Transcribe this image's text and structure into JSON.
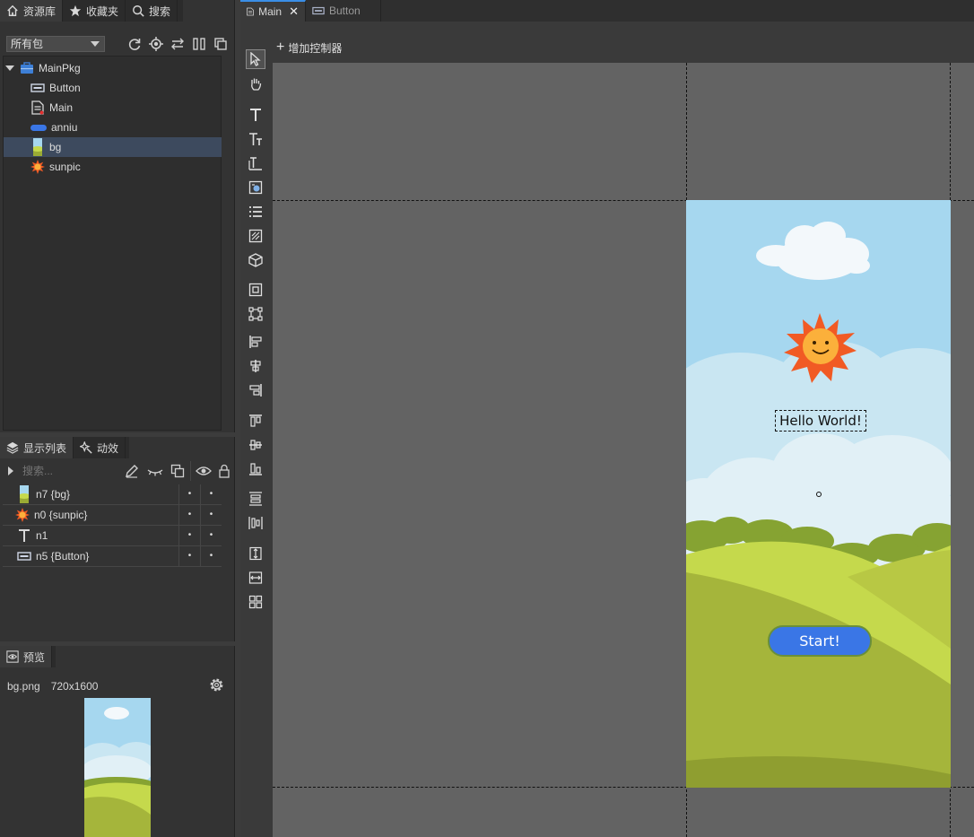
{
  "library": {
    "tabs": [
      {
        "label": "资源库",
        "icon": "home-icon"
      },
      {
        "label": "收藏夹",
        "icon": "star-icon"
      },
      {
        "label": "搜索",
        "icon": "search-icon"
      }
    ],
    "package_select": "所有包",
    "tree": [
      {
        "label": "MainPkg",
        "icon": "package-icon",
        "level": 0,
        "selected": false
      },
      {
        "label": "Button",
        "icon": "button-component-icon",
        "level": 1,
        "selected": false
      },
      {
        "label": "Main",
        "icon": "document-icon",
        "level": 1,
        "selected": false
      },
      {
        "label": "anniu",
        "icon": "blue-pill-image-icon",
        "level": 1,
        "selected": false
      },
      {
        "label": "bg",
        "icon": "background-image-icon",
        "level": 1,
        "selected": true
      },
      {
        "label": "sunpic",
        "icon": "sun-image-icon",
        "level": 1,
        "selected": false
      }
    ]
  },
  "display_list": {
    "tabs": [
      {
        "label": "显示列表",
        "icon": "layers-icon"
      },
      {
        "label": "动效",
        "icon": "sparkle-icon"
      }
    ],
    "search_placeholder": "搜索...",
    "rows": [
      {
        "label": "n7 {bg}",
        "icon": "background-image-icon",
        "v1": "•",
        "v2": "•"
      },
      {
        "label": "n0 {sunpic}",
        "icon": "sun-image-icon",
        "v1": "•",
        "v2": "•"
      },
      {
        "label": "n1",
        "icon": "text-icon",
        "v1": "•",
        "v2": "•"
      },
      {
        "label": "n5 {Button}",
        "icon": "button-component-icon",
        "v1": "•",
        "v2": "•"
      }
    ]
  },
  "preview": {
    "tab_label": "预览",
    "file_name": "bg.png",
    "dimensions": "720x1600"
  },
  "editor": {
    "tabs": [
      {
        "label": "Main",
        "active": true,
        "closable": true
      },
      {
        "label": "Button",
        "active": false,
        "closable": false
      }
    ],
    "add_controller_label": "增加控制器"
  },
  "stage": {
    "hello_text": "Hello World!",
    "button_text": "Start!"
  },
  "colors": {
    "sky": "#a6d7ef",
    "grass_light": "#c5d94c",
    "grass_dark": "#9aab34",
    "button_blue": "#3a76e6",
    "sun_orange": "#f15a24",
    "sun_yellow": "#fbb03b",
    "selection": "#3d4a5e"
  }
}
